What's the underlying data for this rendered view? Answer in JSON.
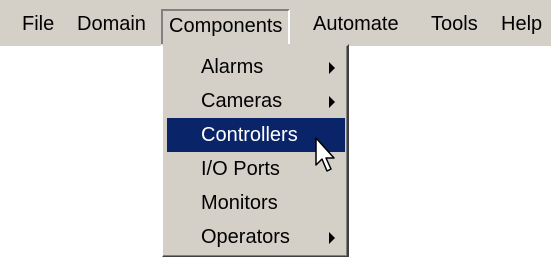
{
  "menubar": {
    "items": [
      {
        "label": "File"
      },
      {
        "label": "Domain"
      },
      {
        "label": "Components"
      },
      {
        "label": "Automate"
      },
      {
        "label": "Tools"
      },
      {
        "label": "Help"
      }
    ]
  },
  "dropdown": {
    "items": [
      {
        "label": "Alarms",
        "has_submenu": true
      },
      {
        "label": "Cameras",
        "has_submenu": true
      },
      {
        "label": "Controllers",
        "has_submenu": false,
        "highlighted": true
      },
      {
        "label": "I/O Ports",
        "has_submenu": false
      },
      {
        "label": "Monitors",
        "has_submenu": false
      },
      {
        "label": "Operators",
        "has_submenu": true
      }
    ]
  },
  "colors": {
    "menu_background": "#d4d0c8",
    "highlight": "#0a246a",
    "highlight_text": "#ffffff"
  },
  "icons": {
    "submenu_arrow": "chevron-right-icon",
    "cursor": "mouse-pointer-icon"
  }
}
